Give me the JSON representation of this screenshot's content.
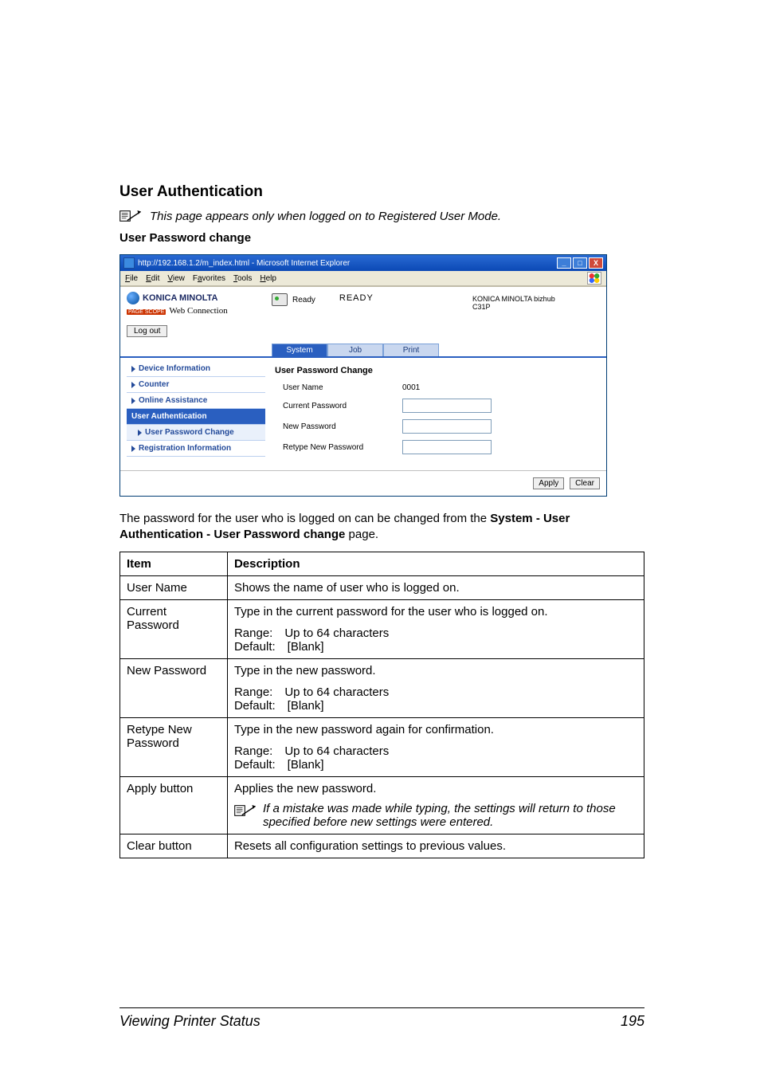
{
  "section_title": "User Authentication",
  "top_note": "This page appears only when logged on to Registered User Mode.",
  "sub_heading": "User Password change",
  "ie": {
    "title": "http://192.168.1.2/m_index.html - Microsoft Internet Explorer",
    "menus": {
      "file": "File",
      "edit": "Edit",
      "view": "View",
      "favorites": "Favorites",
      "tools": "Tools",
      "help": "Help"
    },
    "brand": "KONICA MINOLTA",
    "pagescope_badge": "PAGE SCOPE",
    "pagescope_text": "Web Connection",
    "ready_small": "Ready",
    "ready_big": "READY",
    "device_line1": "KONICA MINOLTA bizhub",
    "device_line2": "C31P",
    "logout": "Log out",
    "tabs": {
      "system": "System",
      "job": "Job",
      "print": "Print"
    },
    "nav": {
      "device_info": "Device Information",
      "counter": "Counter",
      "online_assist": "Online Assistance",
      "user_auth": "User Authentication",
      "user_pw_change": "User Password Change",
      "reg_info": "Registration Information"
    },
    "form": {
      "title": "User Password Change",
      "user_name_label": "User Name",
      "user_name_value": "0001",
      "current_pw_label": "Current Password",
      "new_pw_label": "New Password",
      "retype_pw_label": "Retype New Password",
      "apply": "Apply",
      "clear": "Clear"
    }
  },
  "body_para_pre": "The password for the user who is logged on can be changed from the ",
  "body_para_bold": "System - User Authentication - User Password change",
  "body_para_post": " page.",
  "table": {
    "head_item": "Item",
    "head_desc": "Description",
    "rows": [
      {
        "item": "User Name",
        "desc": [
          "Shows the name of user who is logged on."
        ]
      },
      {
        "item": "Current Password",
        "desc": [
          "Type in the current password for the user who is logged on.",
          "Range: Up to 64 characters",
          "Default: [Blank]"
        ]
      },
      {
        "item": "New Password",
        "desc": [
          "Type in the new password.",
          "Range: Up to 64 characters",
          "Default: [Blank]"
        ]
      },
      {
        "item": "Retype New Password",
        "desc": [
          "Type in the new password again for confirmation.",
          "Range: Up to 64 characters",
          "Default: [Blank]"
        ]
      },
      {
        "item": "Apply button",
        "desc_first": "Applies the new password.",
        "note": "If a mistake was made while typing, the settings will return to those specified before new settings were entered."
      },
      {
        "item": "Clear button",
        "desc": [
          "Resets all configuration settings to previous values."
        ]
      }
    ]
  },
  "footer_left": "Viewing Printer Status",
  "footer_right": "195"
}
